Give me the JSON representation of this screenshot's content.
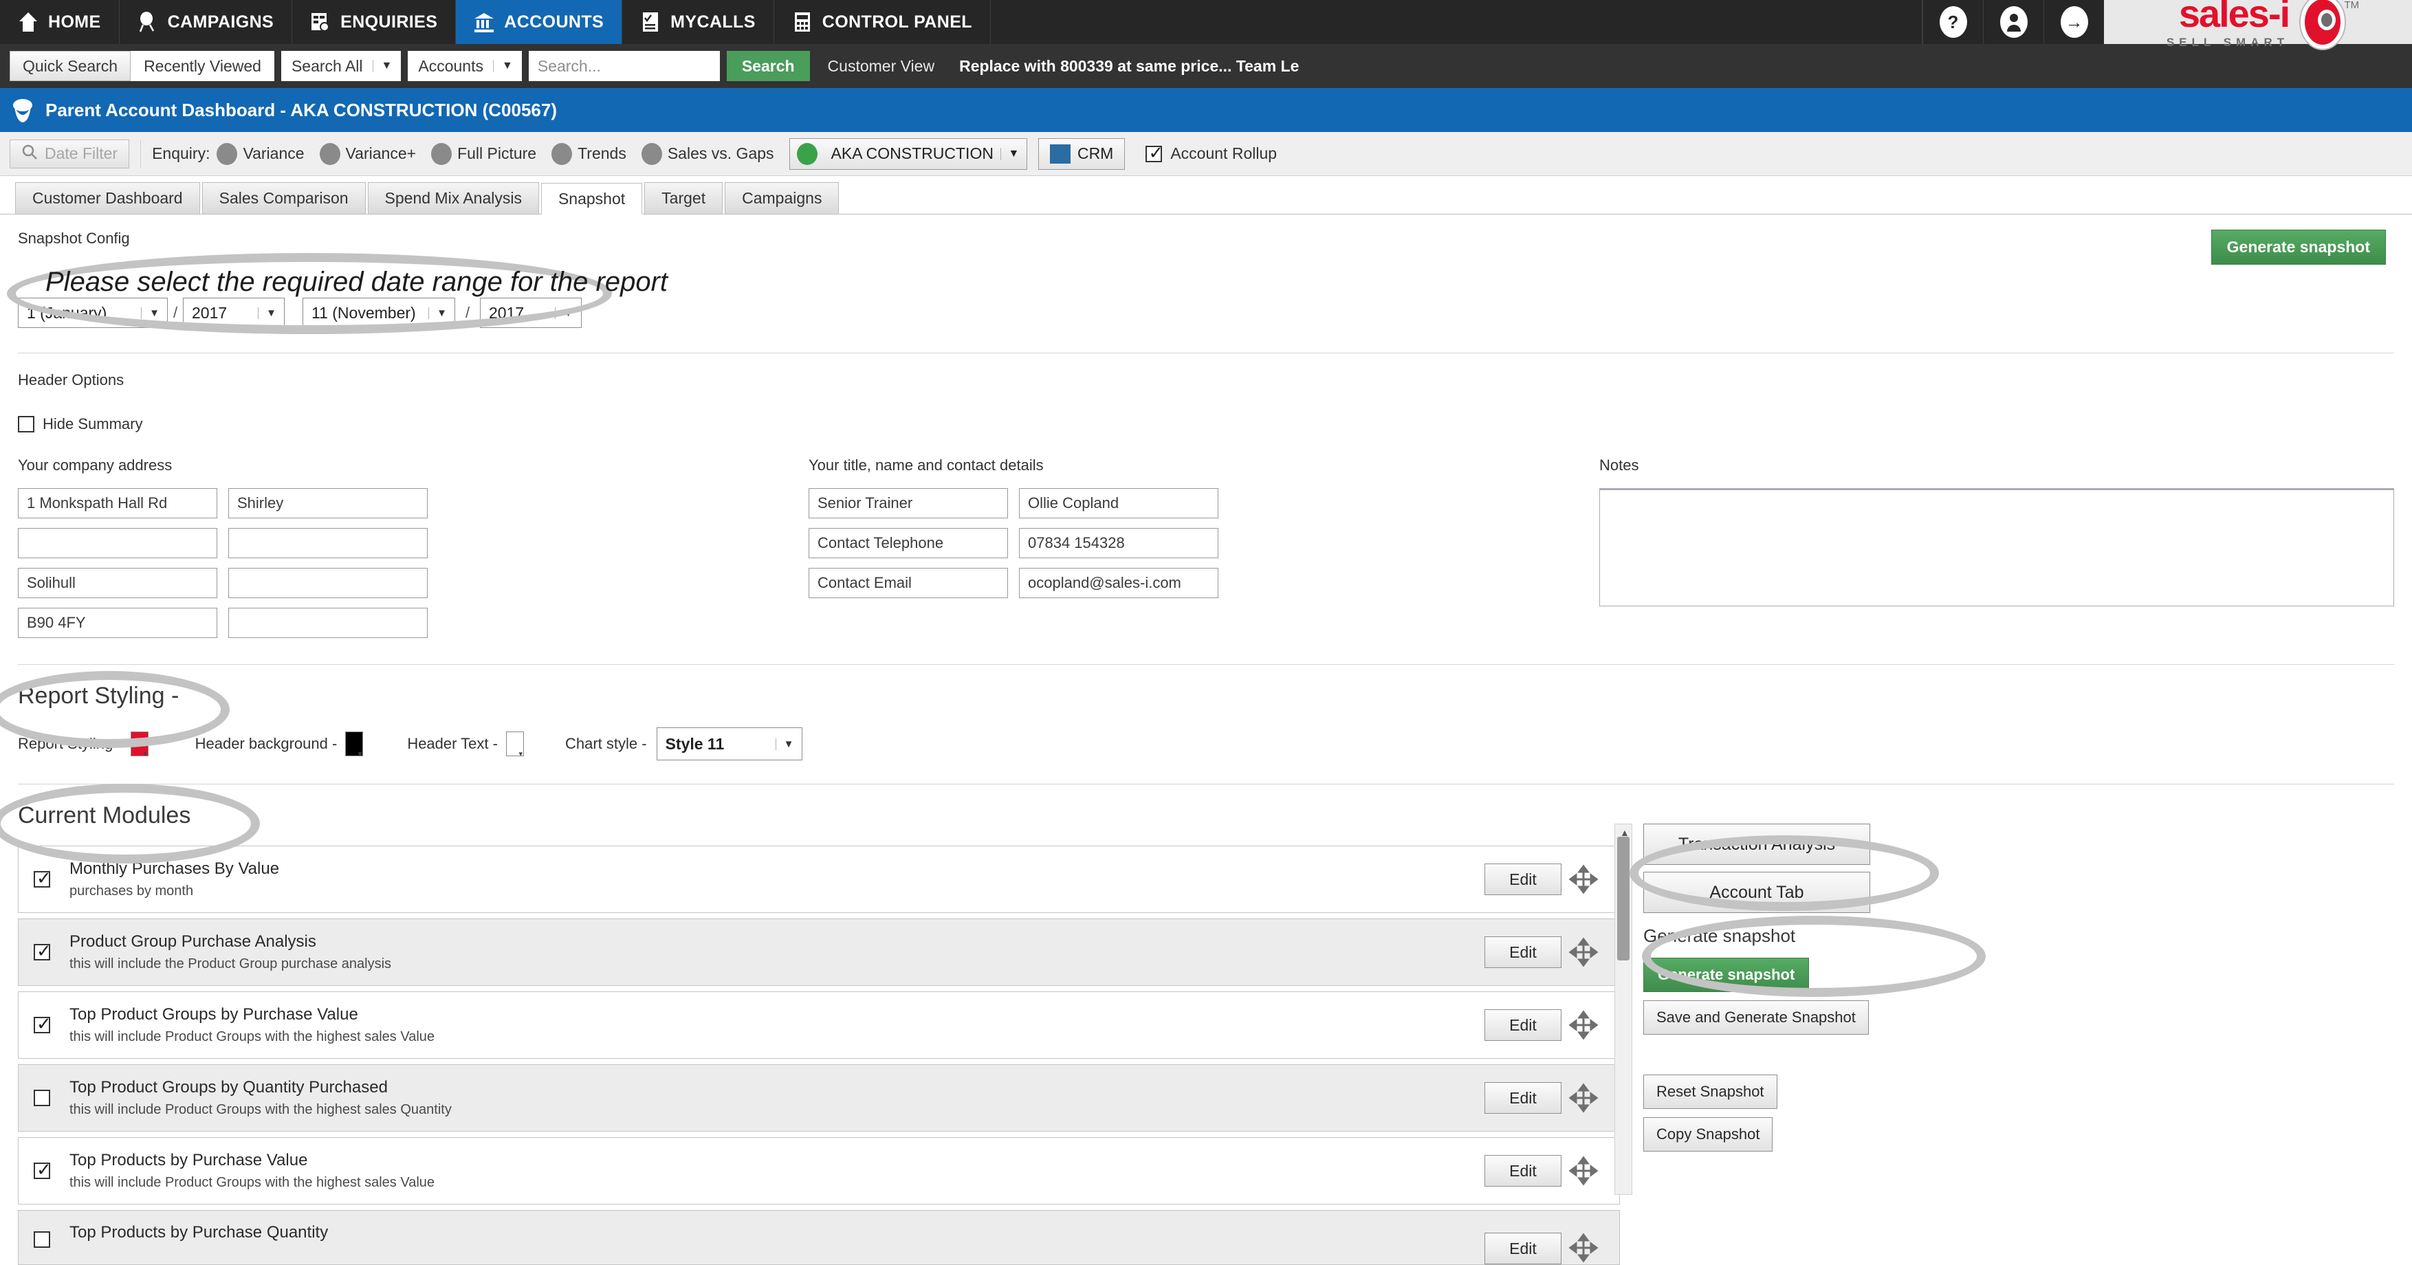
{
  "topnav": {
    "items": [
      {
        "label": "HOME",
        "icon": "home-icon",
        "active": false
      },
      {
        "label": "CAMPAIGNS",
        "icon": "campaign-icon",
        "active": false
      },
      {
        "label": "ENQUIRIES",
        "icon": "enquiries-icon",
        "active": false
      },
      {
        "label": "ACCOUNTS",
        "icon": "accounts-bank-icon",
        "active": true
      },
      {
        "label": "MYCALLS",
        "icon": "mycalls-checklist-icon",
        "active": false
      },
      {
        "label": "CONTROL PANEL",
        "icon": "control-panel-icon",
        "active": false
      }
    ],
    "help_icon": "?",
    "user_icon": "user-icon",
    "logout_icon": "→",
    "logo_text": "sales-i",
    "logo_tagline": "SELL SMART",
    "logo_tm": "TM",
    "logo_color": "#e1112c"
  },
  "searchbar": {
    "quick_search": "Quick Search",
    "recently_viewed": "Recently Viewed",
    "scope_select": "Search All",
    "entity_select": "Accounts",
    "input_placeholder": "Search...",
    "search_button": "Search",
    "customer_view": "Customer View",
    "notice": "Replace with 800339 at same price...  Team Le"
  },
  "titlebar": {
    "title": "Parent Account Dashboard - AKA CONSTRUCTION (C00567)",
    "icon": "acorn-icon",
    "color": "#1268b3"
  },
  "enquirybar": {
    "date_filter": "Date Filter",
    "enquiry_label": "Enquiry:",
    "items": [
      {
        "label": "Variance",
        "icon": "variance-icon"
      },
      {
        "label": "Variance+",
        "icon": "variance-plus-icon"
      },
      {
        "label": "Full Picture",
        "icon": "full-picture-icon"
      },
      {
        "label": "Trends",
        "icon": "trends-icon"
      },
      {
        "label": "Sales vs. Gaps",
        "icon": "sales-gaps-icon"
      }
    ],
    "account_select": "AKA CONSTRUCTION",
    "crm_button": "CRM",
    "account_rollup": "Account Rollup",
    "account_rollup_checked": true
  },
  "tabs": [
    {
      "label": "Customer Dashboard",
      "active": false
    },
    {
      "label": "Sales Comparison",
      "active": false
    },
    {
      "label": "Spend Mix Analysis",
      "active": false
    },
    {
      "label": "Snapshot",
      "active": true
    },
    {
      "label": "Target",
      "active": false
    },
    {
      "label": "Campaigns",
      "active": false
    }
  ],
  "snapshot": {
    "config_label": "Snapshot Config",
    "generate_top_button": "Generate snapshot",
    "date_range": {
      "from_month": "1 (January)",
      "from_year": "2017",
      "separator": "/",
      "to_month": "11 (November)",
      "to_year": "2017"
    }
  },
  "header_options": {
    "section_title": "Header Options",
    "hide_summary_label": "Hide Summary",
    "hide_summary_checked": false,
    "company_address_label": "Your company address",
    "company_address": [
      [
        "1 Monkspath Hall Rd",
        "Shirley"
      ],
      [
        "",
        ""
      ],
      [
        "Solihull",
        ""
      ],
      [
        "B90 4FY",
        ""
      ]
    ],
    "contact_label": "Your title, name and contact details",
    "contact_rows": [
      {
        "label": "Senior Trainer",
        "value": "Ollie Copland"
      },
      {
        "label": "Contact Telephone",
        "value": "07834 154328"
      },
      {
        "label": "Contact Email",
        "value": "ocopland@sales-i.com"
      }
    ],
    "notes_label": "Notes",
    "notes_value": ""
  },
  "report_styling": {
    "section_title": "Report Styling -",
    "report_styling_label": "Report Styling -",
    "report_styling_color": "#e1112c",
    "header_background_label": "Header background -",
    "header_background_color": "#000000",
    "header_text_label": "Header Text -",
    "header_text_color": "#ffffff",
    "chart_style_label": "Chart style -",
    "chart_style_value": "Style 11"
  },
  "current_modules": {
    "section_title": "Current Modules",
    "edit_label": "Edit",
    "move_icon": "move-handle-icon",
    "rows": [
      {
        "title": "Monthly Purchases By Value",
        "desc": "purchases by month",
        "checked": true
      },
      {
        "title": "Product Group Purchase Analysis",
        "desc": "this will include the Product Group purchase analysis",
        "checked": true
      },
      {
        "title": "Top Product Groups by Purchase Value",
        "desc": "this will include Product Groups with the highest sales Value",
        "checked": true
      },
      {
        "title": "Top Product Groups by Quantity Purchased",
        "desc": "this will include Product Groups with the highest sales Quantity",
        "checked": false
      },
      {
        "title": "Top Products by Purchase Value",
        "desc": "this will include Product Groups with the highest sales Value",
        "checked": true
      },
      {
        "title": "Top Products by Purchase Quantity",
        "desc": "",
        "checked": false
      }
    ]
  },
  "side_panel": {
    "transaction_analysis": "Transaction Analysis",
    "account_tab": "Account Tab",
    "generate_label": "Generate snapshot",
    "generate_button": "Generate snapshot",
    "save_generate_button": "Save and Generate Snapshot",
    "reset_button": "Reset Snapshot",
    "copy_button": "Copy Snapshot"
  },
  "annotations": {
    "date_range_note": "Please select the required date range for the report"
  }
}
